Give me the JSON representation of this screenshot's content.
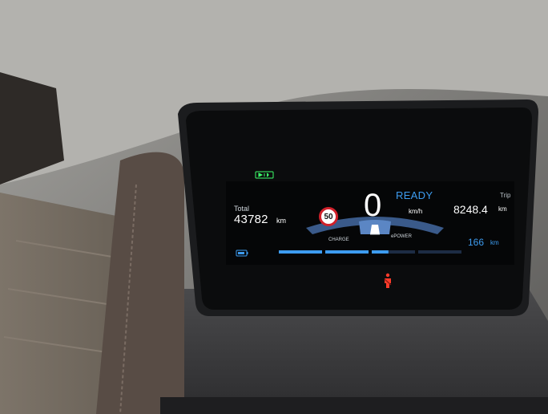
{
  "display": {
    "odometer": {
      "label": "Total",
      "value": "43782",
      "unit": "km"
    },
    "speed_limit_sign": "50",
    "speed": {
      "value": "0",
      "unit": "km/h"
    },
    "status": "READY",
    "trip": {
      "label": "Trip",
      "value": "8248.4",
      "unit": "km"
    },
    "power_meter": {
      "left_label": "CHARGE",
      "right_label": "ePOWER"
    },
    "range": {
      "value": "166",
      "unit": "km"
    },
    "battery_level": 0.6
  },
  "icons": [
    "ready-drive-indicator-icon",
    "battery-icon",
    "seatbelt-warning-icon"
  ],
  "colors": {
    "accent_blue": "#3d9cf0",
    "warning_red": "#d0202a",
    "indicator_green": "#3cff6a"
  }
}
